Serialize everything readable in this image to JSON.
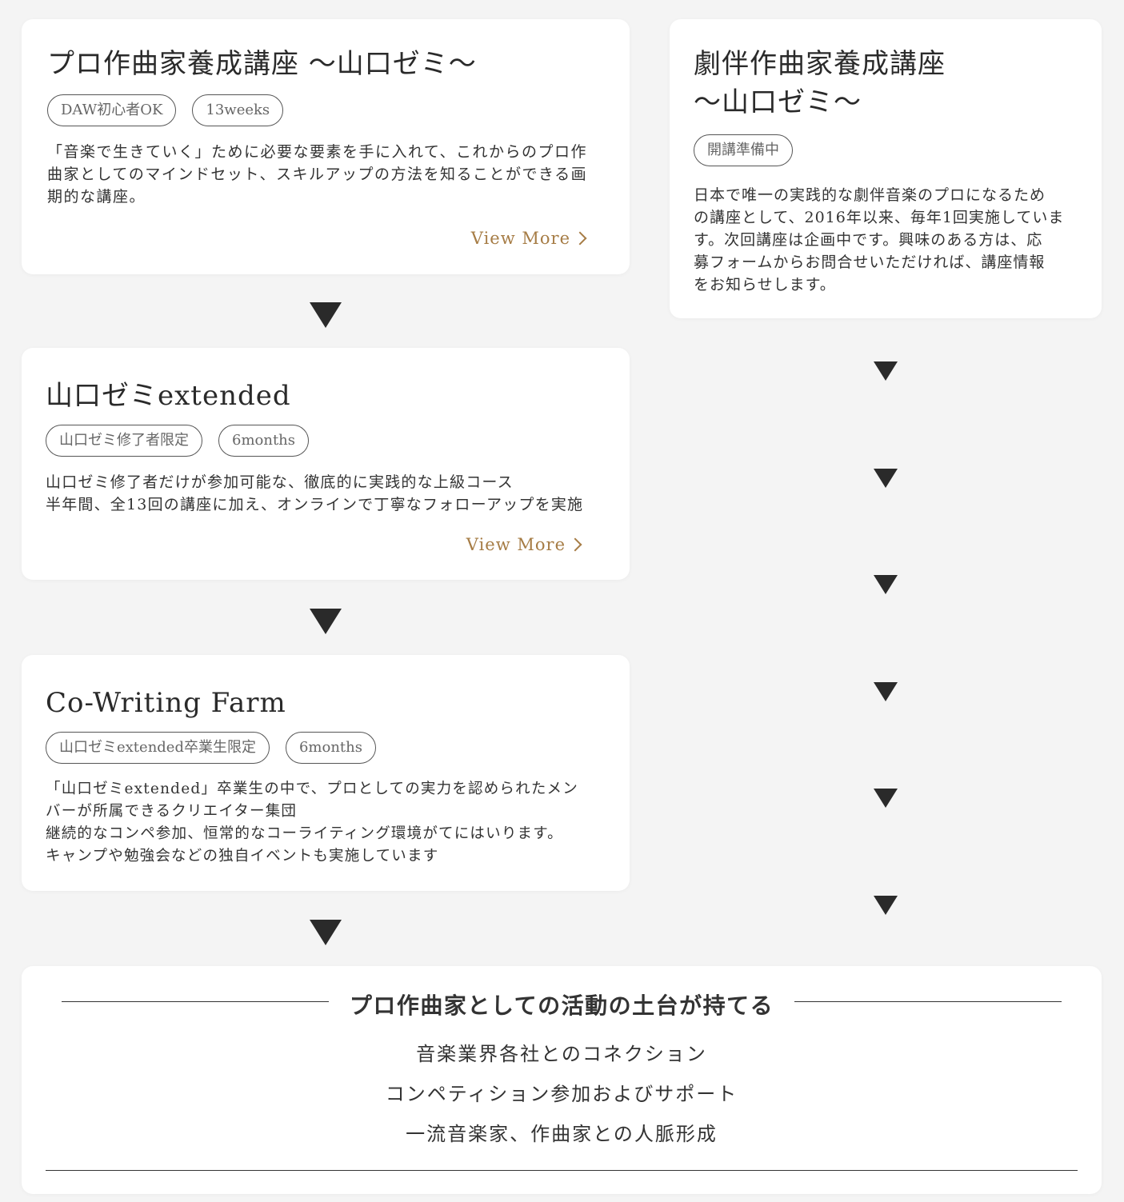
{
  "card1": {
    "title": "プロ作曲家養成講座 〜山口ゼミ〜",
    "tags": [
      "DAW初心者OK",
      "13weeks"
    ],
    "description": "「音楽で生きていく」ために必要な要素を手に入れて、これからのプロ作\n曲家としてのマインドセット、スキルアップの方法を知ることができる画\n期的な講座。",
    "view_more": "View More"
  },
  "card2": {
    "title": "劇伴作曲家養成講座\n〜山口ゼミ〜",
    "tags": [
      "開講準備中"
    ],
    "description": "日本で唯一の実践的な劇伴音楽のプロになるため\nの講座として、2016年以来、毎年1回実施していま\nす。次回講座は企画中です。興味のある方は、応\n募フォームからお問合せいただければ、講座情報\nをお知らせします。"
  },
  "card3": {
    "title": "山口ゼミextended",
    "tags": [
      "山口ゼミ修了者限定",
      "6months"
    ],
    "description": "山口ゼミ修了者だけが参加可能な、徹底的に実践的な上級コース\n半年間、全13回の講座に加え、オンラインで丁寧なフォローアップを実施",
    "view_more": "View More"
  },
  "card4": {
    "title": "Co-Writing Farm",
    "tags": [
      "山口ゼミextended卒業生限定",
      "6months"
    ],
    "description": "「山口ゼミextended」卒業生の中で、プロとしての実力を認められたメン\nバーが所属できるクリエイター集団\n継続的なコンペ参加、恒常的なコーライティング環境がてにはいります。\nキャンプや勉強会などの独自イベントも実施しています"
  },
  "bottom": {
    "heading": "プロ作曲家としての活動の土台が持てる",
    "benefits": [
      "音楽業界各社とのコネクション",
      "コンペティション参加およびサポート",
      "一流音楽家、作曲家との人脈形成"
    ]
  },
  "colors": {
    "background": "#f4f4f4",
    "card": "#ffffff",
    "accent": "#a67c45",
    "arrow": "#2a2a2a"
  }
}
